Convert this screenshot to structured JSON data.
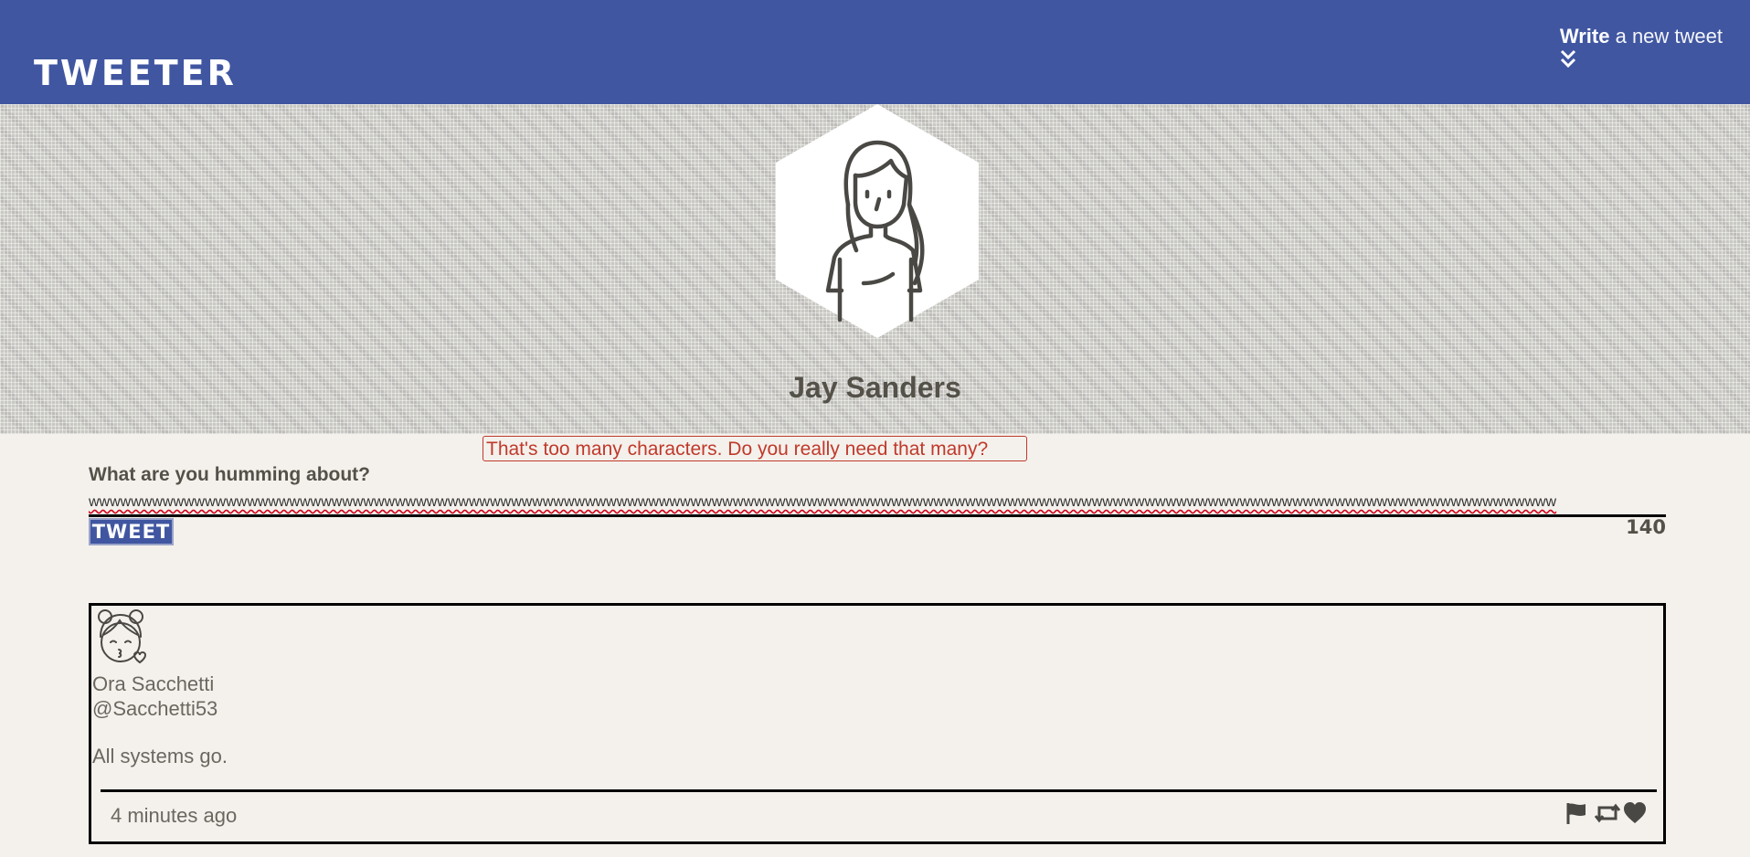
{
  "nav": {
    "brand": "TWEETER",
    "compose_bold": "Write",
    "compose_rest": " a new tweet",
    "compose_icon": "double-chevron-down-icon"
  },
  "header": {
    "avatar_icon": "user-avatar-icon",
    "user_name": "Jay Sanders"
  },
  "compose": {
    "error_message": "That's too many characters. Do you really need that many?",
    "prompt": "What are you humming about?",
    "text_value": "wwwwwwwwwwwwwwwwwwwwwwwwwwwwwwwwwwwwwwwwwwwwwwwwwwwwwwwwwwwwwwwwwwwwwwwwwwwwwwwwwwwwwwwwwwwwwwwwwwwwwwwwwwwwwwwwwwwwwwwwwwwwwwwwwwwwwwwwwww",
    "button_label": "TWEET",
    "counter": "140"
  },
  "tweets": [
    {
      "author_name": "Ora Sacchetti",
      "handle": "@Sacchetti53",
      "content": "All systems go.",
      "timestamp": "4 minutes ago",
      "avatar_icon": "girl-kiss-avatar-icon",
      "actions": [
        "flag-icon",
        "retweet-icon",
        "heart-icon"
      ]
    }
  ],
  "colors": {
    "nav_bg": "#4056a1",
    "page_bg": "#f4f1ec",
    "text": "#545149",
    "error": "#c0392b"
  }
}
